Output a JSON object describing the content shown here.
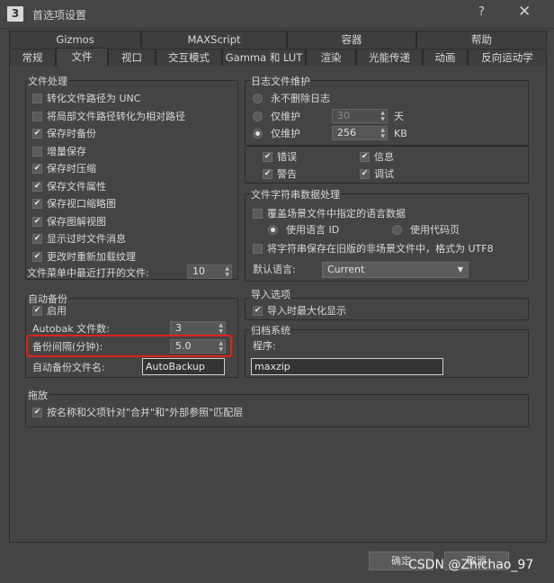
{
  "window": {
    "title": "首选项设置",
    "help": "?",
    "close": "✕",
    "icon_text": "3"
  },
  "tabs_top": [
    "Gizmos",
    "MAXScript",
    "容器",
    "帮助"
  ],
  "tabs_bottom": [
    "常规",
    "文件",
    "视口",
    "交互模式",
    "Gamma 和 LUT",
    "渲染",
    "光能传递",
    "动画",
    "反向运动学"
  ],
  "file_handling": {
    "label": "文件处理",
    "items": [
      {
        "label": "转化文件路径为 UNC",
        "checked": false
      },
      {
        "label": "将局部文件路径转化为相对路径",
        "checked": false
      },
      {
        "label": "保存时备份",
        "checked": true
      },
      {
        "label": "增量保存",
        "checked": false
      },
      {
        "label": "保存时压缩",
        "checked": true
      },
      {
        "label": "保存文件属性",
        "checked": true
      },
      {
        "label": "保存视口缩略图",
        "checked": true
      },
      {
        "label": "保存图解视图",
        "checked": true
      },
      {
        "label": "显示过时文件消息",
        "checked": true
      },
      {
        "label": "更改时重新加载纹理",
        "checked": true
      }
    ],
    "recent_label": "文件菜单中最近打开的文件:",
    "recent_value": "10"
  },
  "log": {
    "label": "日志文件维护",
    "never_delete": "永不删除日志",
    "keep1_label": "仅维护",
    "keep1_value": "30",
    "keep1_unit": "天",
    "keep2_label": "仅维护",
    "keep2_value": "256",
    "keep2_unit": "KB",
    "levels": [
      {
        "label": "错误",
        "checked": true
      },
      {
        "label": "信息",
        "checked": true
      },
      {
        "label": "警告",
        "checked": true
      },
      {
        "label": "调试",
        "checked": true
      }
    ]
  },
  "strings": {
    "label": "文件字符串数据处理",
    "override": "覆盖场景文件中指定的语言数据",
    "use_lang_id": "使用语言 ID",
    "use_codepage": "使用代码页",
    "save_utf8": "将字符串保存在旧版的非场景文件中，格式为 UTF8",
    "default_lang_label": "默认语言:",
    "default_lang_value": "Current"
  },
  "autobackup": {
    "label": "自动备份",
    "enable": "启用",
    "count_label": "Autobak 文件数:",
    "count_value": "3",
    "interval_label": "备份间隔(分钟):",
    "interval_value": "5.0",
    "name_label": "自动备份文件名:",
    "name_value": "AutoBackup"
  },
  "import": {
    "label": "导入选项",
    "maximize": "导入时最大化显示"
  },
  "archive": {
    "label": "归档系统",
    "program_label": "程序:",
    "program_value": "maxzip"
  },
  "drag": {
    "label": "拖放",
    "option": "按名称和父项针对\"合并\"和\"外部参照\"匹配层"
  },
  "buttons": {
    "ok": "确定",
    "cancel": "取消"
  },
  "watermark": "CSDN @Zhichao_97",
  "colors": {
    "highlight": "#e0211a",
    "background": "#444444"
  }
}
